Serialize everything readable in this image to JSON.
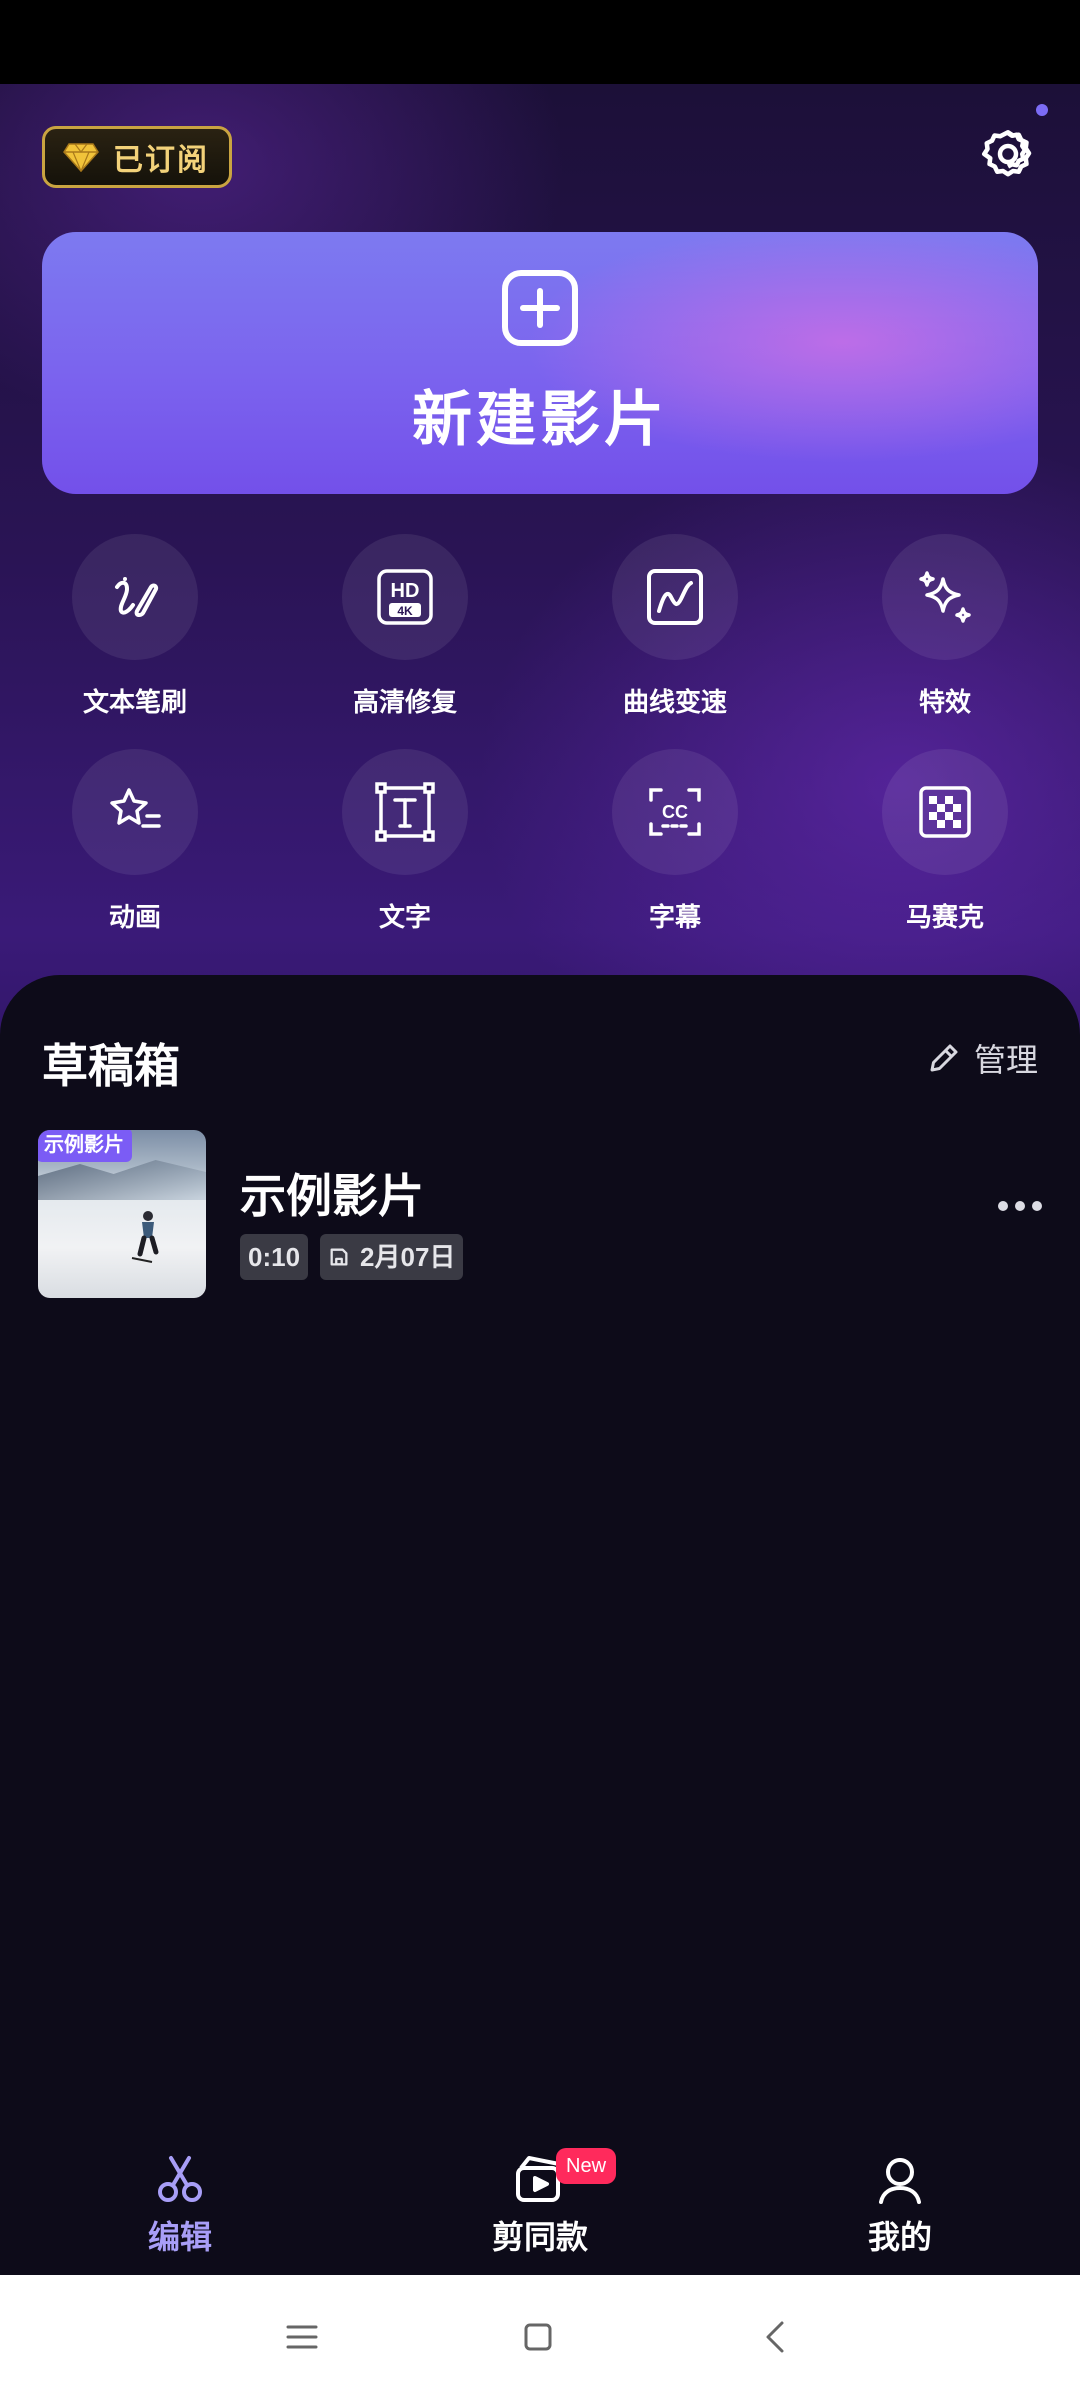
{
  "header": {
    "subscription_badge": "已订阅",
    "settings_icon": "gear-icon",
    "has_notification": true
  },
  "new_movie": {
    "label": "新建影片",
    "icon": "plus-square-icon"
  },
  "tools": [
    {
      "label": "文本笔刷",
      "icon": "text-brush-icon"
    },
    {
      "label": "高清修复",
      "icon": "hd-4k-icon"
    },
    {
      "label": "曲线变速",
      "icon": "curve-speed-icon"
    },
    {
      "label": "特效",
      "icon": "sparkles-icon"
    },
    {
      "label": "动画",
      "icon": "star-animation-icon"
    },
    {
      "label": "文字",
      "icon": "text-box-icon"
    },
    {
      "label": "字幕",
      "icon": "cc-icon"
    },
    {
      "label": "马赛克",
      "icon": "mosaic-icon"
    }
  ],
  "drafts": {
    "title": "草稿箱",
    "manage_label": "管理",
    "items": [
      {
        "thumb_tag": "示例影片",
        "name": "示例影片",
        "duration": "0:10",
        "date": "2月07日"
      }
    ]
  },
  "bottom_nav": {
    "items": [
      {
        "label": "编辑",
        "icon": "scissors-icon",
        "active": true
      },
      {
        "label": "剪同款",
        "icon": "template-camera-icon",
        "badge": "New"
      },
      {
        "label": "我的",
        "icon": "person-icon"
      }
    ]
  },
  "colors": {
    "accent": "#7b5cf5",
    "active_nav": "#a89ef7",
    "badge_gold": "#f3d27a",
    "new_badge": "#ff2a5c"
  }
}
